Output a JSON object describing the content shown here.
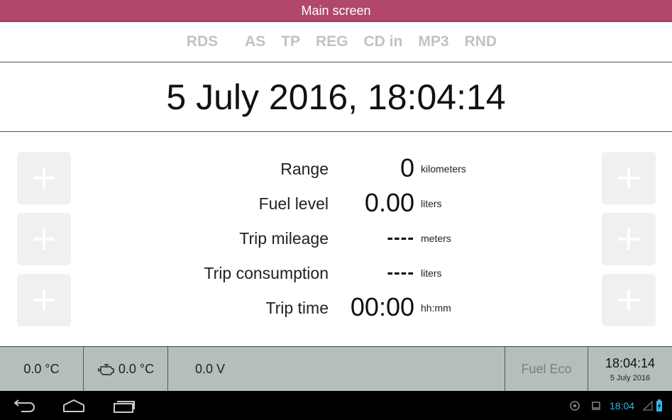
{
  "title": "Main screen",
  "modes": [
    "RDS",
    "AS",
    "TP",
    "REG",
    "CD in",
    "MP3",
    "RND"
  ],
  "datetime": "5 July 2016, 18:04:14",
  "readings": [
    {
      "label": "Range",
      "value": "0",
      "unit": "kilometers"
    },
    {
      "label": "Fuel level",
      "value": "0.00",
      "unit": "liters"
    },
    {
      "label": "Trip mileage",
      "value": "----",
      "unit": "meters"
    },
    {
      "label": "Trip consumption",
      "value": "----",
      "unit": "liters"
    },
    {
      "label": "Trip time",
      "value": "00:00",
      "unit": "hh:mm"
    }
  ],
  "status": {
    "outside_temp": "0.0 °C",
    "engine_temp": "0.0 °C",
    "voltage": "0.0 V",
    "fuel_eco": "Fuel Eco",
    "time": "18:04:14",
    "date": "5 July 2016"
  },
  "system": {
    "clock": "18:04"
  },
  "colors": {
    "title_bg": "#b1476a",
    "status_bg": "#b4bfbc",
    "mode_text": "#c2c2c2",
    "clock": "#33b5e5"
  },
  "icons": [
    "back-icon",
    "home-icon",
    "recent-apps-icon",
    "engine-icon",
    "gps-icon",
    "screenshot-icon",
    "signal-icon",
    "battery-icon",
    "plus-icon"
  ]
}
